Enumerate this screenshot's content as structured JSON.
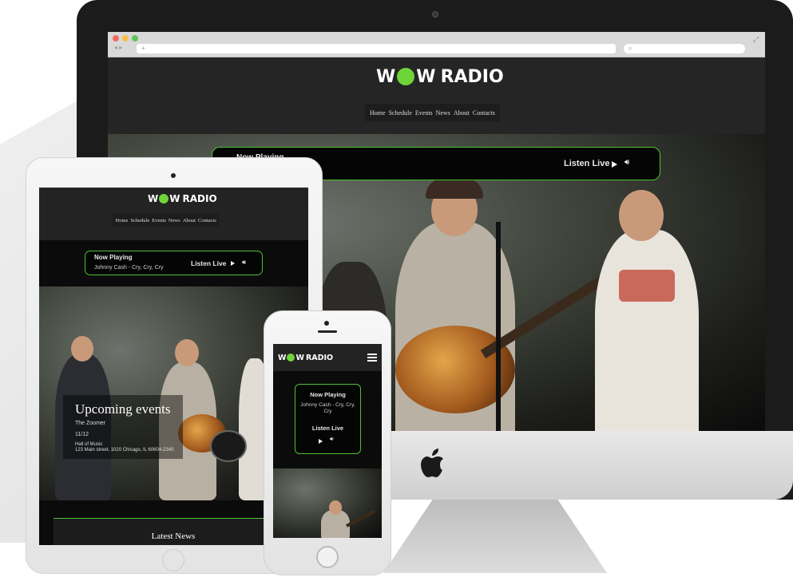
{
  "brand": {
    "logo_left": "W",
    "logo_right": "RADIO",
    "accent_color": "#6fd43a",
    "border_color": "#4cc232"
  },
  "nav": {
    "items": [
      "Home",
      "Schedule",
      "Events",
      "News",
      "About",
      "Contacts"
    ]
  },
  "player": {
    "now_playing_label": "Now Playing",
    "track": "Johnny Cash - Cry, Cry, Cry",
    "listen_live_label": "Listen Live",
    "play_icon": "play-icon",
    "volume_icon": "speaker-icon"
  },
  "events": {
    "heading": "Upcoming events",
    "event_name": "The Zoomer",
    "date": "11/12",
    "venue": "Hall of Music",
    "address": "123 Main street, 1020 Chicago, IL 60604-2340"
  },
  "news": {
    "heading": "Latest News"
  },
  "icons": {
    "hamburger": "menu-icon",
    "apple": "apple-logo"
  }
}
